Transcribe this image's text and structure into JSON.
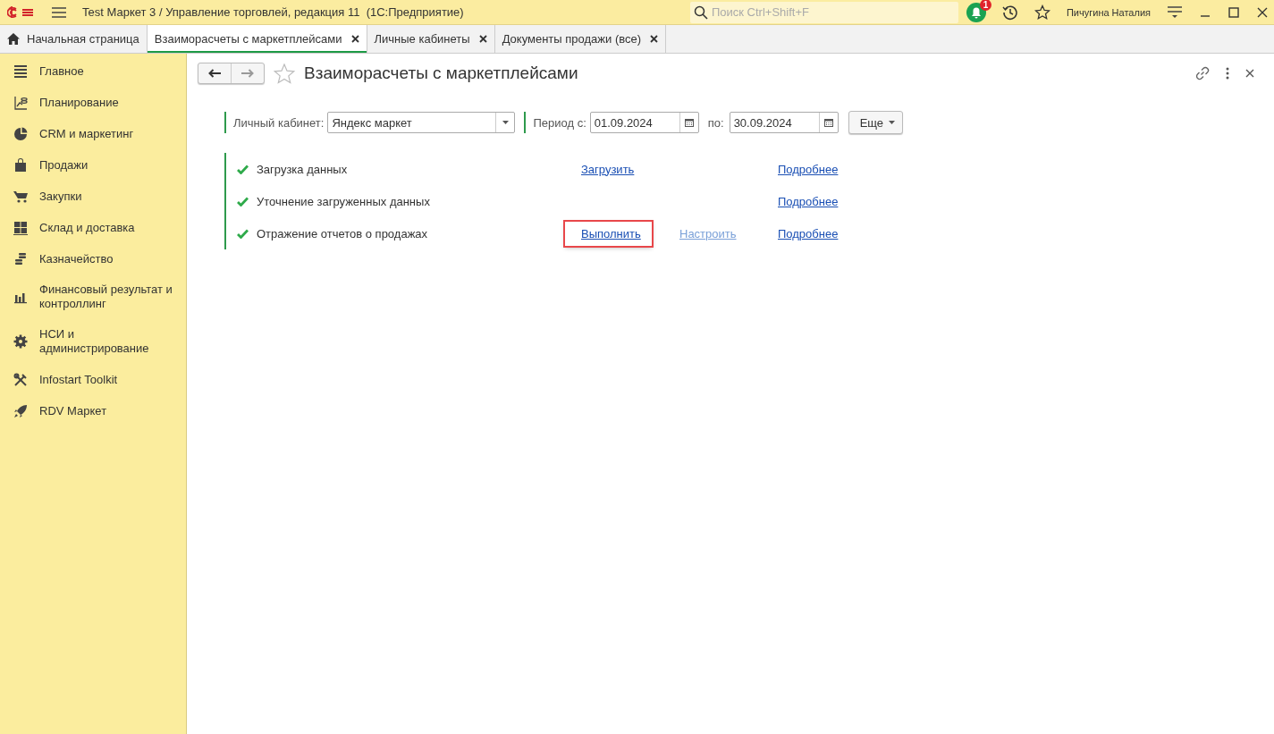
{
  "window": {
    "title": "Test Маркет 3 / Управление торговлей, редакция 11  (1С:Предприятие)"
  },
  "search": {
    "placeholder": "Поиск Ctrl+Shift+F"
  },
  "notifications": {
    "count": "1"
  },
  "user": {
    "name": "Пичугина Наталия"
  },
  "tabs": [
    {
      "label": "Начальная страница",
      "kind": "home",
      "selected": false
    },
    {
      "label": "Взаиморасчеты с маркетплейсами",
      "kind": "doc",
      "selected": true
    },
    {
      "label": "Личные кабинеты",
      "kind": "doc",
      "selected": false
    },
    {
      "label": "Документы продажи (все)",
      "kind": "doc",
      "selected": false
    }
  ],
  "sidebar": {
    "items": [
      {
        "label": "Главное"
      },
      {
        "label": "Планирование"
      },
      {
        "label": "CRM и маркетинг"
      },
      {
        "label": "Продажи"
      },
      {
        "label": "Закупки"
      },
      {
        "label": "Склад и доставка"
      },
      {
        "label": "Казначейство"
      },
      {
        "label": "Финансовый результат и контроллинг"
      },
      {
        "label": "НСИ и администрирование"
      },
      {
        "label": "Infostart Toolkit"
      },
      {
        "label": "RDV Маркет"
      }
    ]
  },
  "form": {
    "title": "Взаиморасчеты с маркетплейсами",
    "favorite": false,
    "account": {
      "label": "Личный кабинет:",
      "value": "Яндекс маркет"
    },
    "period": {
      "from_label": "Период с:",
      "from": "01.09.2024",
      "to_label": "по:",
      "to": "30.09.2024"
    },
    "more_button": "Еще",
    "steps": [
      {
        "label": "Загрузка данных",
        "done": true,
        "action": {
          "label": "Загрузить",
          "highlighted": false
        },
        "details": "Подробнее"
      },
      {
        "label": "Уточнение загруженных данных",
        "done": true,
        "details": "Подробнее"
      },
      {
        "label": "Отражение отчетов о продажах",
        "done": true,
        "action": {
          "label": "Выполнить",
          "highlighted": true
        },
        "setup": {
          "label": "Настроить",
          "disabled": true
        },
        "details": "Подробнее"
      }
    ]
  }
}
